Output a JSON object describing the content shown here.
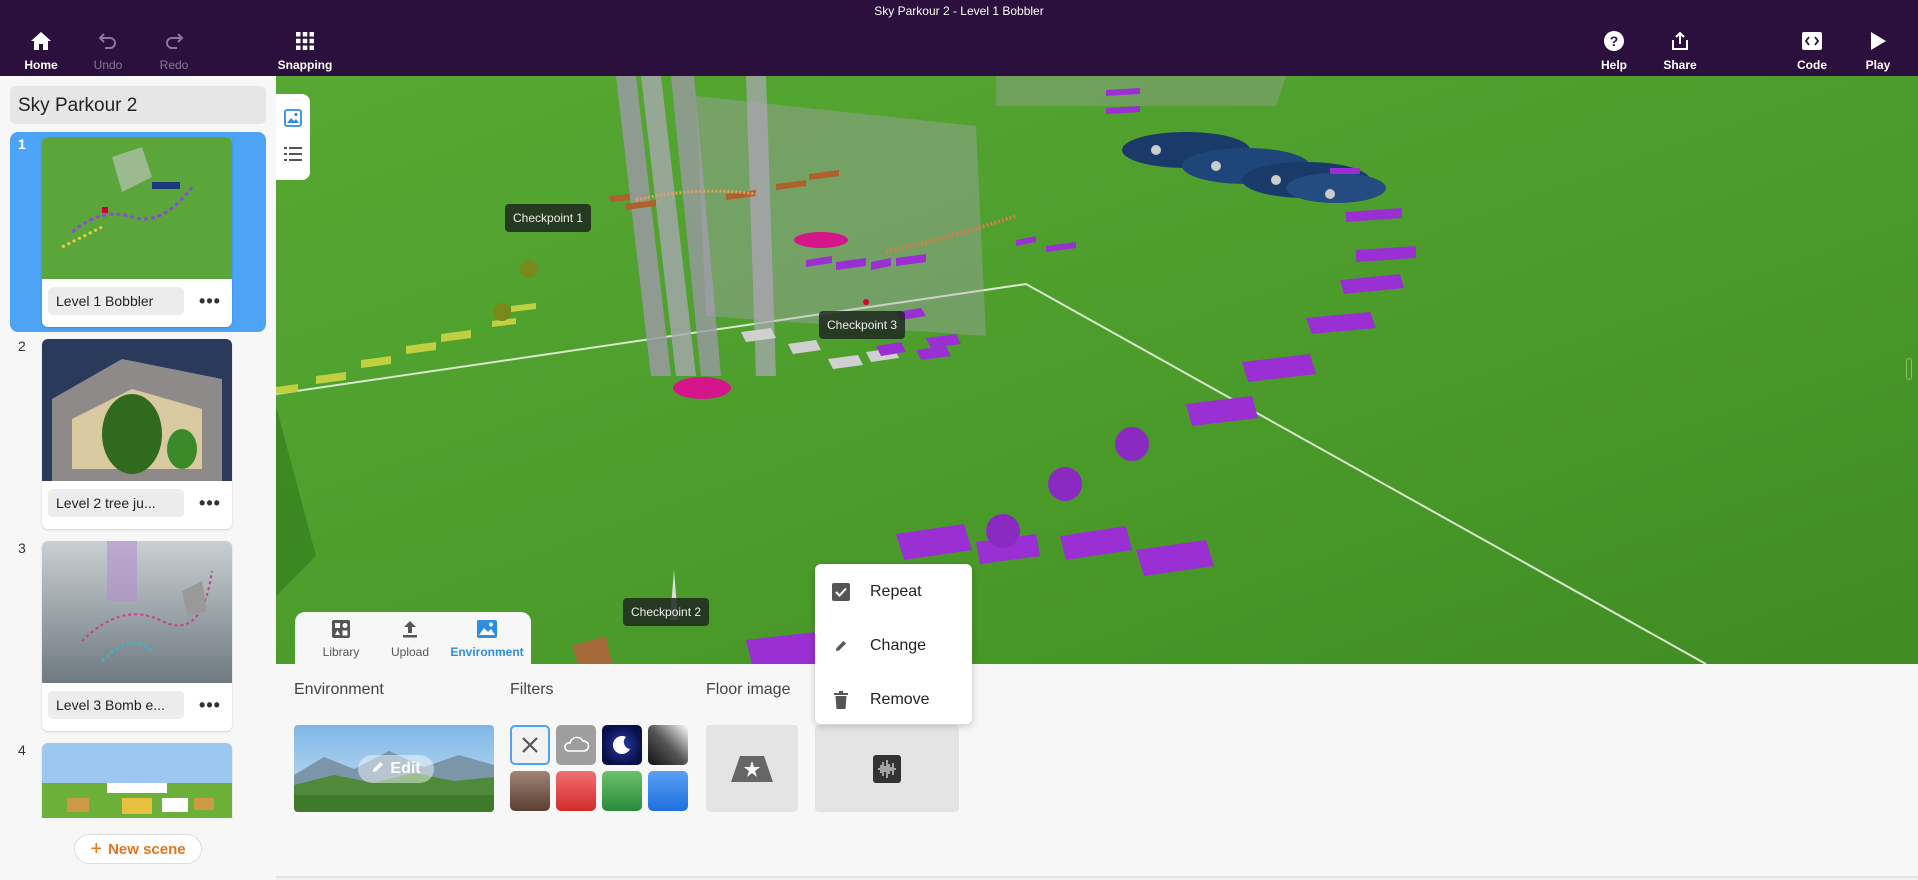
{
  "window": {
    "title": "Sky Parkour 2 - Level 1 Bobbler"
  },
  "toolbar": {
    "home": "Home",
    "undo": "Undo",
    "redo": "Redo",
    "snapping": "Snapping",
    "help": "Help",
    "share": "Share",
    "code": "Code",
    "play": "Play"
  },
  "sidebar": {
    "project_title": "Sky Parkour 2",
    "scenes": [
      {
        "number": "1",
        "name": "Level 1 Bobbler"
      },
      {
        "number": "2",
        "name": "Level 2 tree ju..."
      },
      {
        "number": "3",
        "name": "Level 3 Bomb e..."
      },
      {
        "number": "4",
        "name": ""
      }
    ],
    "new_scene": "New scene"
  },
  "viewport": {
    "checkpoints": [
      "Checkpoint 1",
      "Checkpoint 3",
      "Checkpoint 2"
    ]
  },
  "panel_tabs": {
    "library": "Library",
    "upload": "Upload",
    "environment": "Environment"
  },
  "environment_panel": {
    "environment_label": "Environment",
    "filters_label": "Filters",
    "floor_image_label": "Floor image",
    "edit_label": "Edit"
  },
  "filter_colors": [
    "#ffffff",
    "#9e9e9e",
    "#0c1a6b",
    "#444444",
    "#8a6a58",
    "#e63b3b",
    "#3fa84a",
    "#2d7de8"
  ],
  "context_menu": {
    "repeat": "Repeat",
    "change": "Change",
    "remove": "Remove"
  }
}
